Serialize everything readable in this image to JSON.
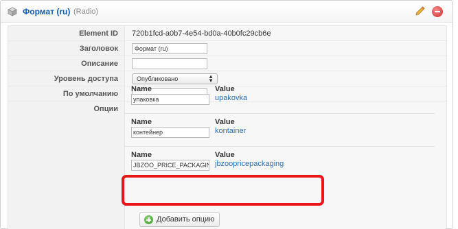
{
  "header": {
    "title": "Формат (ru)",
    "subtitle": "(Radio)"
  },
  "fields": {
    "element_id": {
      "label": "Element ID",
      "value": "720b1fcd-a0b7-4e54-bd0a-40b0fc29cb6e"
    },
    "title": {
      "label": "Заголовок",
      "value": "Формат (ru)"
    },
    "description": {
      "label": "Описание",
      "value": ""
    },
    "access": {
      "label": "Уровень доступа",
      "value": "Опубликовано"
    },
    "default": {
      "label": "По умолчанию",
      "value": ""
    },
    "options_label": "Опции"
  },
  "options": {
    "name_label": "Name",
    "value_label": "Value",
    "items": [
      {
        "name": "упаковка",
        "value": "upakovka"
      },
      {
        "name": "контейнер",
        "value": "kontainer"
      },
      {
        "name": "JBZOO_PRICE_PACKAGING",
        "value": "jbzoopricepackaging"
      }
    ],
    "add_button": "Добавить опцию"
  },
  "colors": {
    "title": "#135cae",
    "link": "#2a6fb3",
    "highlight": "#e8141a"
  }
}
